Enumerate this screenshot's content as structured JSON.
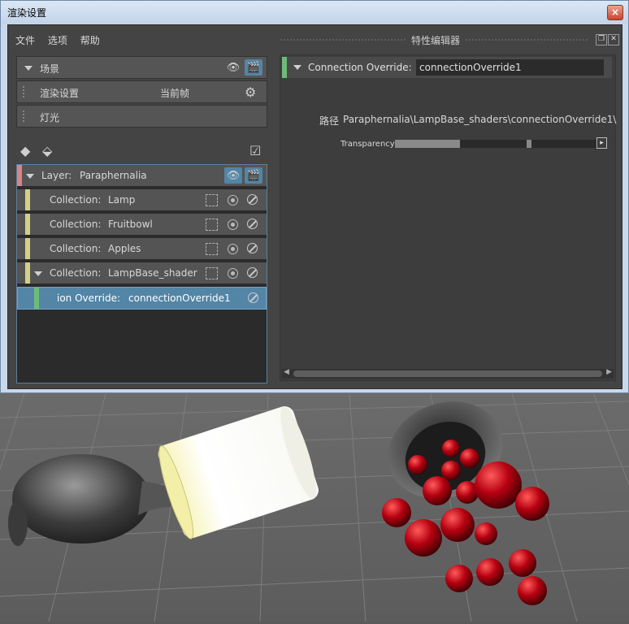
{
  "window": {
    "title": "渲染设置",
    "close": "×"
  },
  "menu": [
    "文件",
    "选项",
    "帮助"
  ],
  "scene_rows": {
    "scene": "场景",
    "render_settings": "渲染设置",
    "render_settings_value": "当前帧",
    "lights": "灯光"
  },
  "tree": {
    "layer": {
      "prefix": "Layer:",
      "name": "Paraphernalia"
    },
    "collections": [
      {
        "prefix": "Collection:",
        "name": "Lamp"
      },
      {
        "prefix": "Collection:",
        "name": "Fruitbowl"
      },
      {
        "prefix": "Collection:",
        "name": "Apples"
      },
      {
        "prefix": "Collection:",
        "name": "LampBase_shader"
      }
    ],
    "override": {
      "prefix": "ion Override:",
      "name": "connectionOverride1"
    }
  },
  "editor": {
    "title": "特性编辑器",
    "header_label": "Connection Override:",
    "header_value": "connectionOverride1",
    "path_label": "路径",
    "path_value": "Paraphernalia\\LampBase_shaders\\connectionOverride1\\",
    "attr_label": "Transparency",
    "transparency_fraction": 0.32
  },
  "colors": {
    "layer_bar": "#d98585",
    "collection_bar": "#d3cf86",
    "override_bar": "#6dbb7a",
    "selected_row": "#5285a6"
  }
}
